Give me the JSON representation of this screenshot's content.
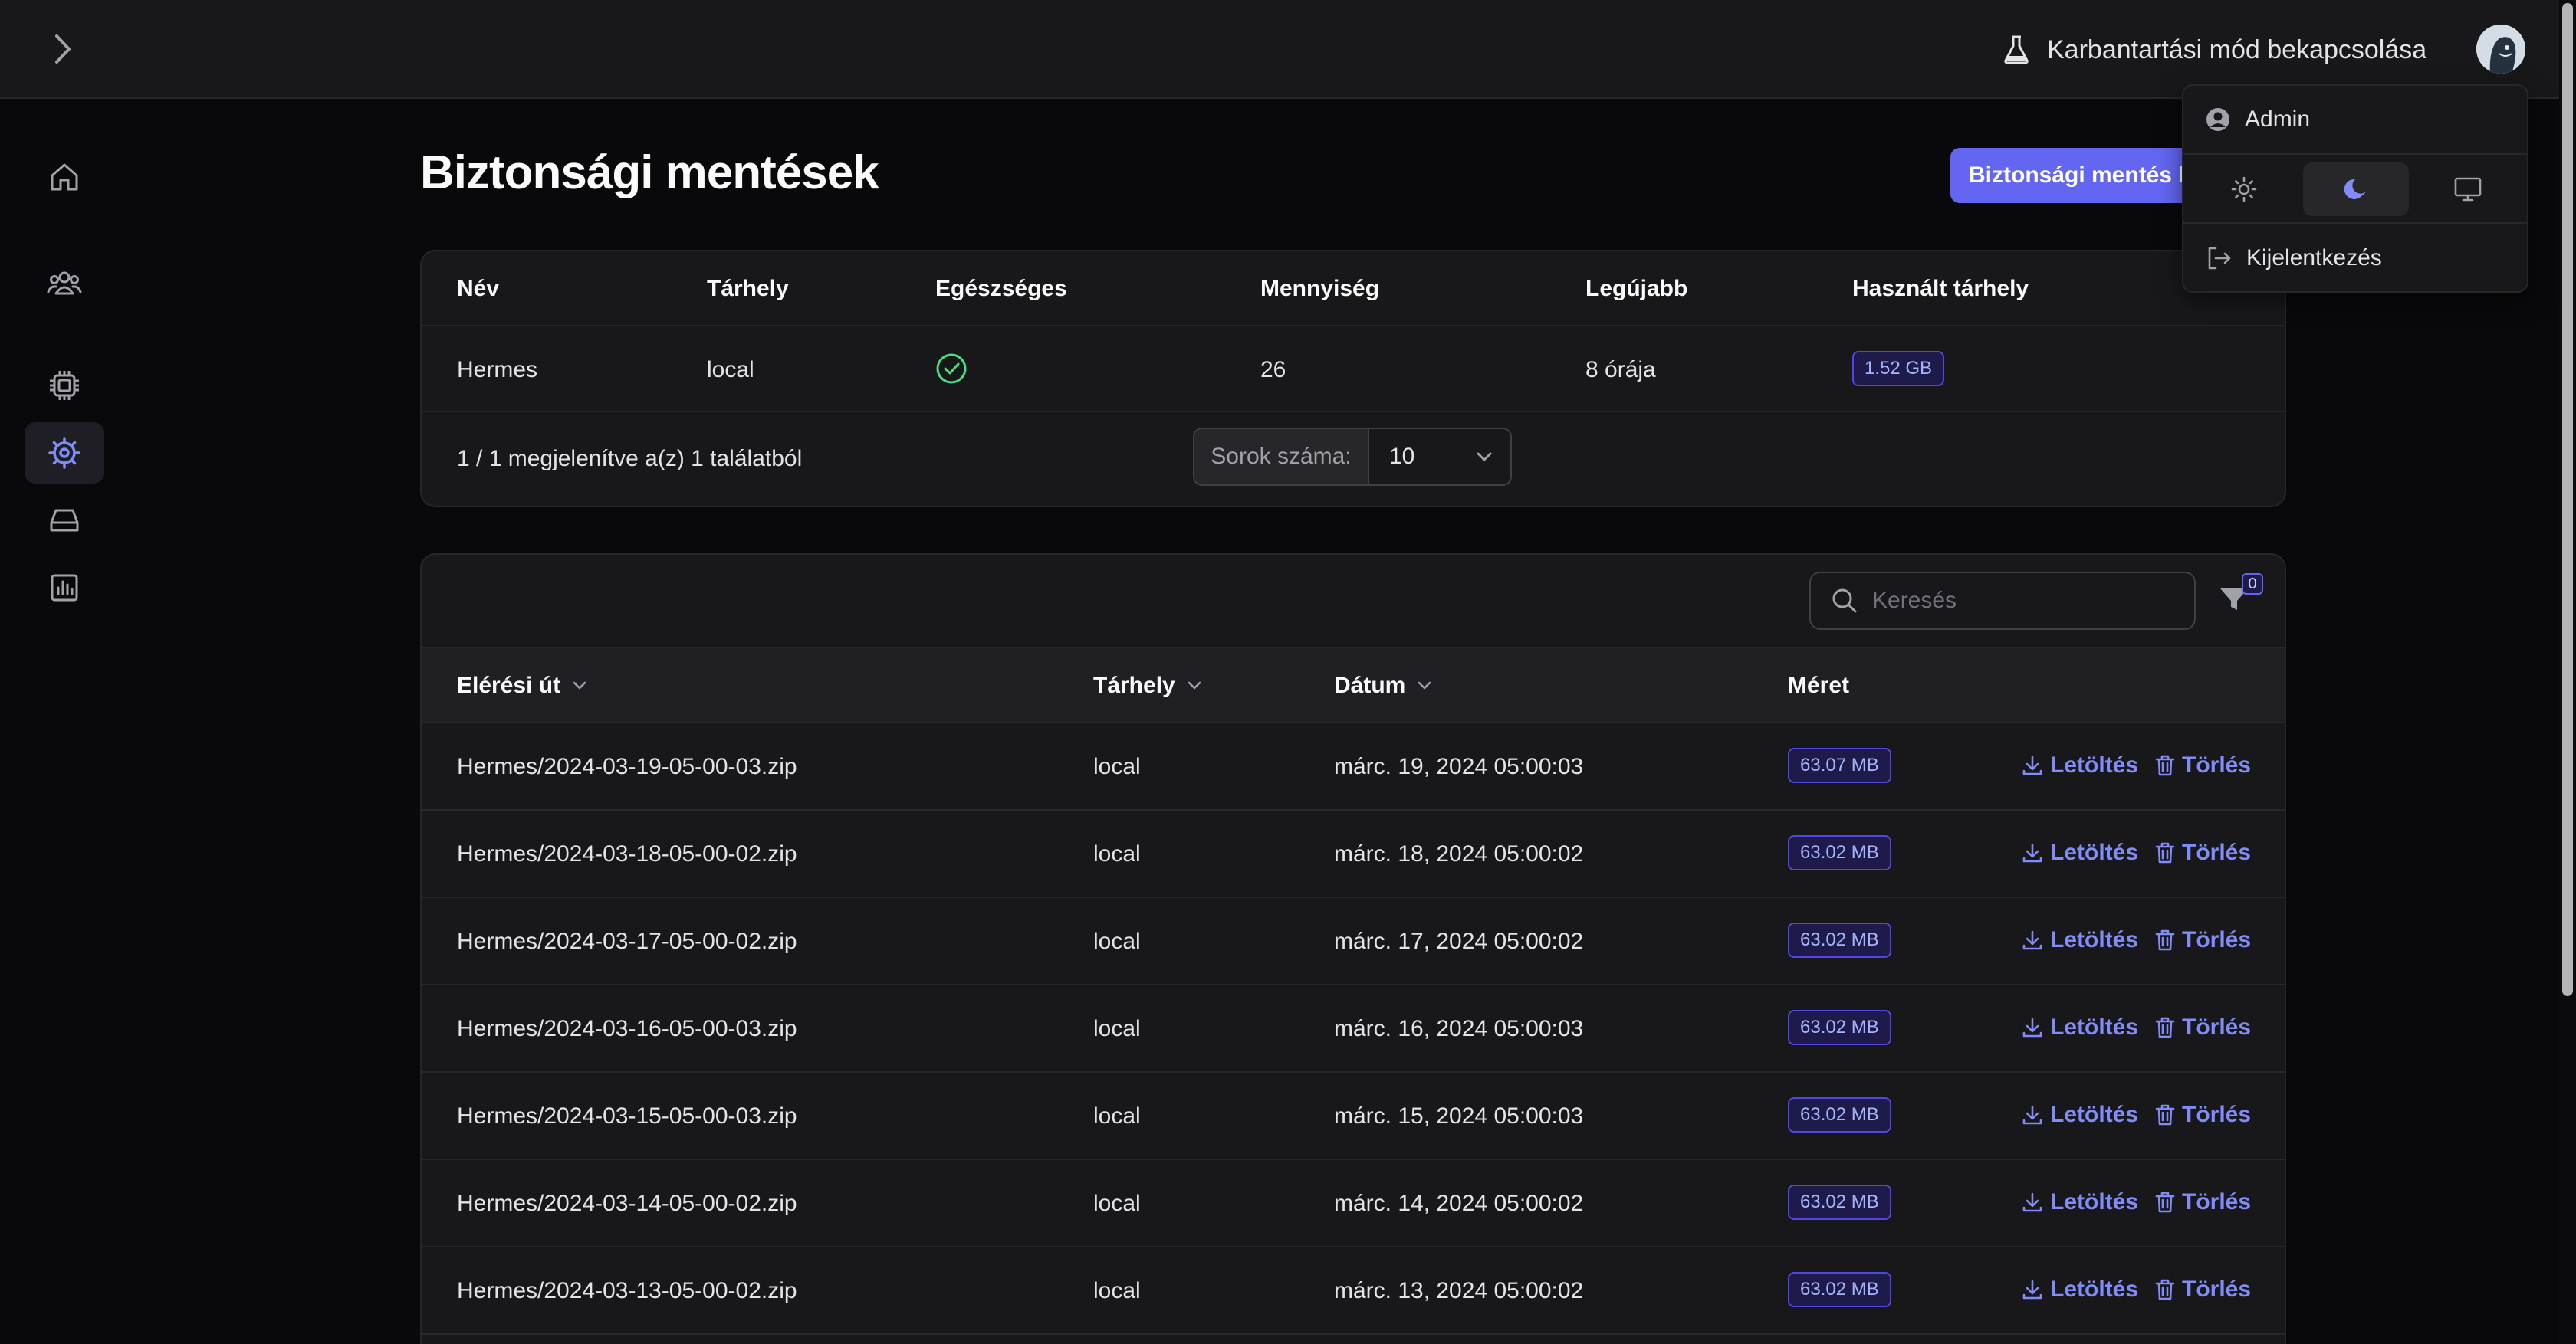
{
  "topbar": {
    "toggle_icon": "chevron-right-icon",
    "maintenance_label": "Karbantartási mód bekapcsolása",
    "maintenance_icon": "flask-icon"
  },
  "sidebar": {
    "items": [
      {
        "name": "home",
        "icon": "home-icon",
        "active": false
      },
      {
        "name": "users",
        "icon": "users-icon",
        "active": false
      },
      {
        "name": "cpu",
        "icon": "cpu-icon",
        "active": false
      },
      {
        "name": "settings",
        "icon": "gear-icon",
        "active": true
      },
      {
        "name": "storage",
        "icon": "hard-drive-icon",
        "active": false
      },
      {
        "name": "stats",
        "icon": "chart-icon",
        "active": false
      }
    ]
  },
  "page": {
    "title": "Biztonsági mentések",
    "create_button": "Biztonsági mentés készítése"
  },
  "summary": {
    "headers": {
      "name": "Név",
      "disk": "Tárhely",
      "healthy": "Egészséges",
      "amount": "Mennyiség",
      "newest": "Legújabb",
      "used": "Használt tárhely"
    },
    "row": {
      "name": "Hermes",
      "disk": "local",
      "healthy": true,
      "amount": "26",
      "newest": "8 órája",
      "used": "1.52 GB"
    },
    "pagination_text": "1 / 1 megjelenítve a(z) 1 találatból",
    "rows_label": "Sorok száma:",
    "rows_value": "10"
  },
  "backups": {
    "search_placeholder": "Keresés",
    "filter_count": "0",
    "headers": {
      "path": "Elérési út",
      "disk": "Tárhely",
      "date": "Dátum",
      "size": "Méret"
    },
    "download_label": "Letöltés",
    "delete_label": "Törlés",
    "rows": [
      {
        "path": "Hermes/2024-03-19-05-00-03.zip",
        "disk": "local",
        "date": "márc. 19, 2024 05:00:03",
        "size": "63.07 MB"
      },
      {
        "path": "Hermes/2024-03-18-05-00-02.zip",
        "disk": "local",
        "date": "márc. 18, 2024 05:00:02",
        "size": "63.02 MB"
      },
      {
        "path": "Hermes/2024-03-17-05-00-02.zip",
        "disk": "local",
        "date": "márc. 17, 2024 05:00:02",
        "size": "63.02 MB"
      },
      {
        "path": "Hermes/2024-03-16-05-00-03.zip",
        "disk": "local",
        "date": "márc. 16, 2024 05:00:03",
        "size": "63.02 MB"
      },
      {
        "path": "Hermes/2024-03-15-05-00-03.zip",
        "disk": "local",
        "date": "márc. 15, 2024 05:00:03",
        "size": "63.02 MB"
      },
      {
        "path": "Hermes/2024-03-14-05-00-02.zip",
        "disk": "local",
        "date": "márc. 14, 2024 05:00:02",
        "size": "63.02 MB"
      },
      {
        "path": "Hermes/2024-03-13-05-00-02.zip",
        "disk": "local",
        "date": "márc. 13, 2024 05:00:02",
        "size": "63.02 MB"
      }
    ]
  },
  "user_menu": {
    "username": "Admin",
    "logout_label": "Kijelentkezés",
    "theme_options": [
      "light",
      "dark",
      "system"
    ],
    "theme_selected": "dark"
  },
  "colors": {
    "accent": "#6366f1",
    "accent_text": "#818cf8",
    "success": "#4ade80",
    "background": "#09090b",
    "surface": "#18181b"
  }
}
